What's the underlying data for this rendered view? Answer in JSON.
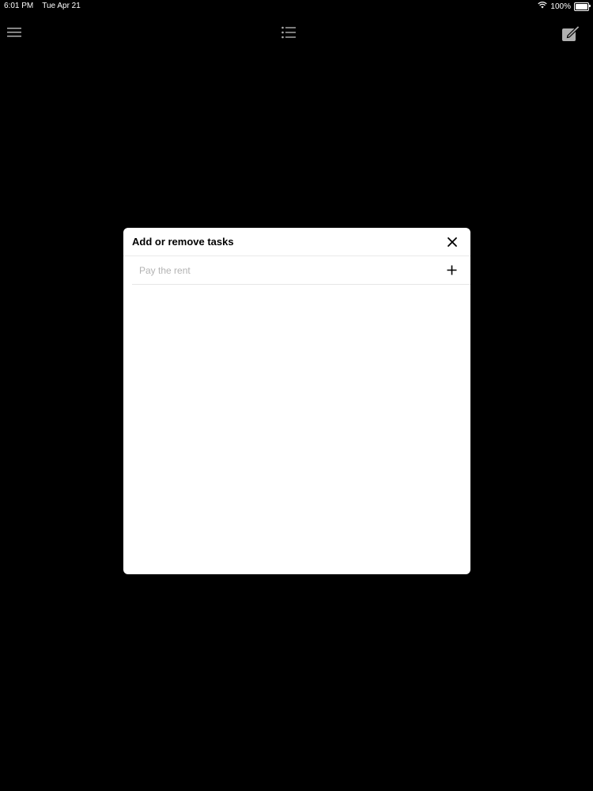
{
  "status_bar": {
    "time": "6:01 PM",
    "date": "Tue Apr 21",
    "battery": "100%",
    "icons": [
      "wifi-icon",
      "battery-icon"
    ]
  },
  "toolbar": {
    "icons": [
      "hamburger-menu-icon",
      "list-icon",
      "compose-icon"
    ]
  },
  "modal": {
    "title": "Add or remove tasks",
    "task_input": {
      "placeholder": "Pay the rent",
      "value": ""
    },
    "icons": [
      "close-icon",
      "plus-icon"
    ]
  },
  "colors": {
    "background": "#000000",
    "modal_background": "#ffffff",
    "toolbar_icon": "#b0b0b0",
    "placeholder": "#b3b3b3",
    "divider": "#e6e6e6"
  }
}
